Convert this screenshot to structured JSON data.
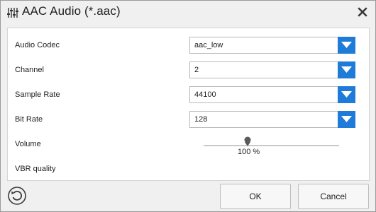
{
  "window": {
    "title": "AAC Audio (*.aac)",
    "title_icon": "equalizer-icon",
    "close_icon": "close-icon"
  },
  "settings": {
    "audio_codec": {
      "label": "Audio Codec",
      "value": "aac_low"
    },
    "channel": {
      "label": "Channel",
      "value": "2"
    },
    "sample_rate": {
      "label": "Sample Rate",
      "value": "44100"
    },
    "bit_rate": {
      "label": "Bit Rate",
      "value": "128"
    },
    "volume": {
      "label": "Volume",
      "value_text": "100 %",
      "level_fraction": 0.29
    },
    "vbr_quality": {
      "label": "VBR quality"
    }
  },
  "footer": {
    "reset_icon": "reset-icon",
    "ok_label": "OK",
    "cancel_label": "Cancel"
  },
  "colors": {
    "accent": "#1e7bd8",
    "panel_bg": "#ffffff",
    "window_bg": "#f0f0f0"
  }
}
